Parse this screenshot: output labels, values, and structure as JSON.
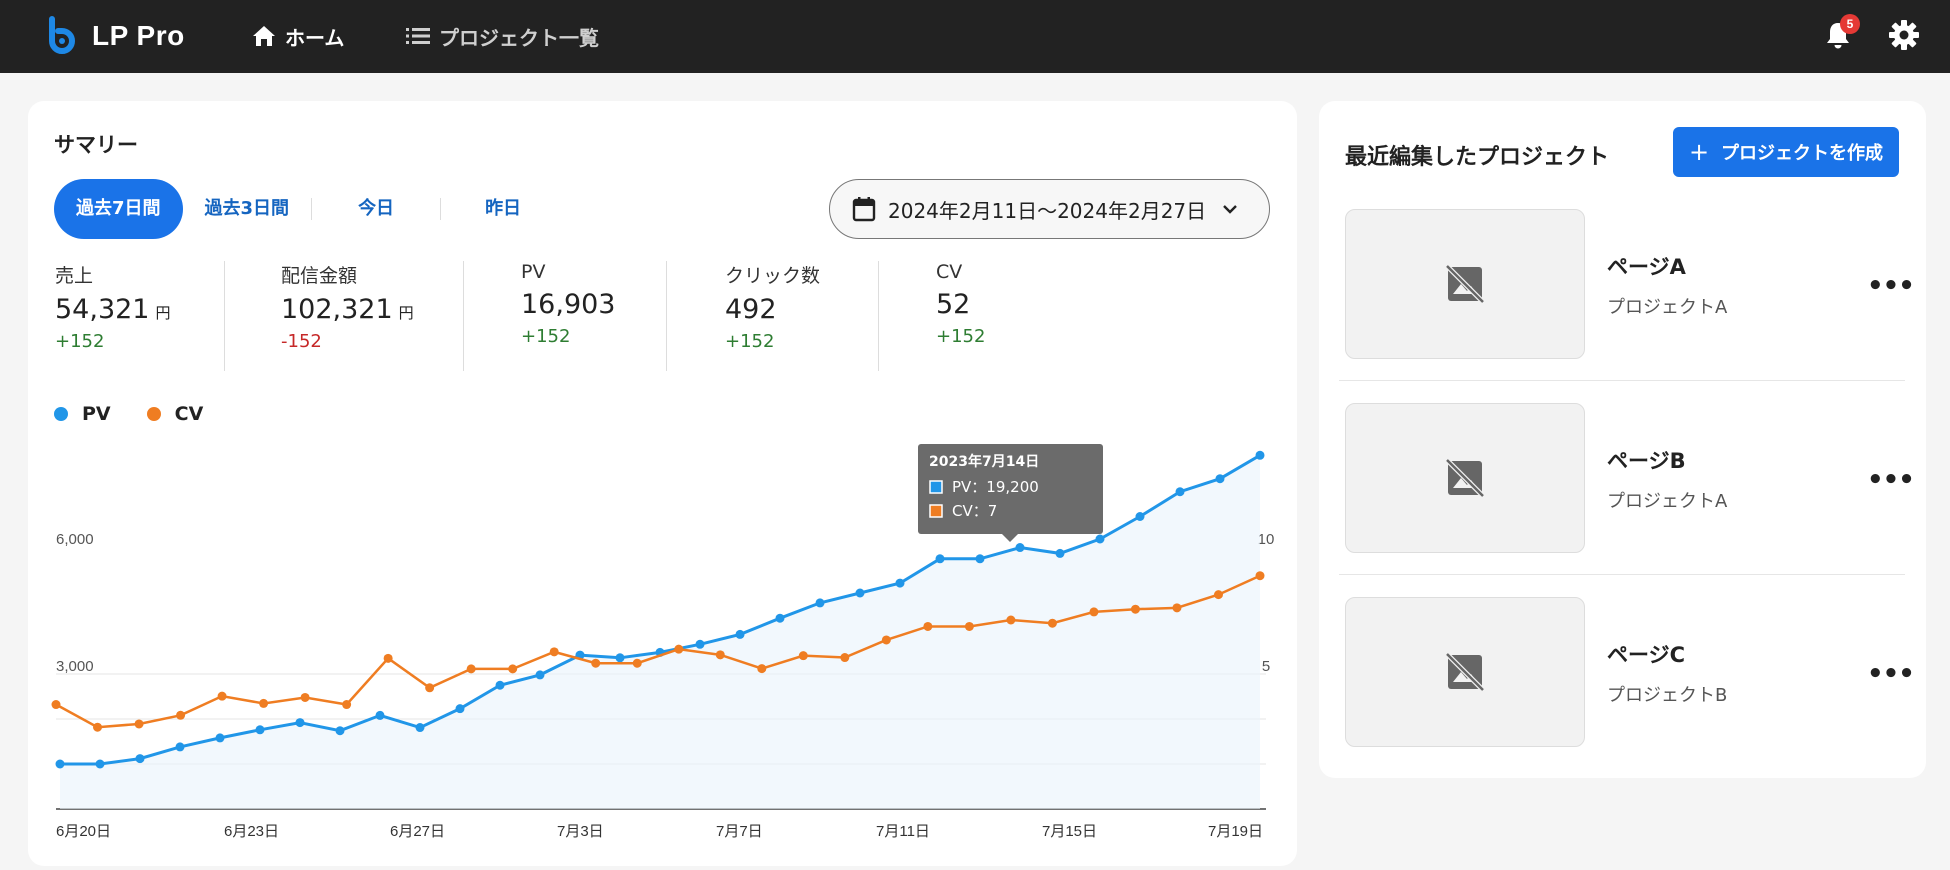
{
  "header": {
    "logo_text": "LP Pro",
    "nav": [
      {
        "label": "ホーム",
        "icon": "home-icon"
      },
      {
        "label": "プロジェクト一覧",
        "icon": "list-icon"
      }
    ],
    "notification_count": "5"
  },
  "summary": {
    "title": "サマリー",
    "range_tabs": [
      "過去7日間",
      "過去3日間",
      "今日",
      "昨日"
    ],
    "active_range": "過去7日間",
    "date_range": "2024年2月11日〜2024年2月27日",
    "kpis": [
      {
        "label": "売上",
        "value": "54,321",
        "unit": "円",
        "delta": "+152"
      },
      {
        "label": "配信金額",
        "value": "102,321",
        "unit": "円",
        "delta": "-152"
      },
      {
        "label": "PV",
        "value": "16,903",
        "unit": "",
        "delta": "+152"
      },
      {
        "label": "クリック数",
        "value": "492",
        "unit": "",
        "delta": "+152"
      },
      {
        "label": "CV",
        "value": "52",
        "unit": "",
        "delta": "+152"
      }
    ],
    "legend": [
      "PV",
      "CV"
    ]
  },
  "chart_data": {
    "type": "line",
    "series": [
      {
        "name": "PV",
        "color": "#2196e8",
        "axis": "left",
        "values": [
          1000,
          1000,
          1120,
          1380,
          1580,
          1760,
          1920,
          1740,
          2080,
          1810,
          2230,
          2750,
          2980,
          3420,
          3360,
          3480,
          3660,
          3880,
          4240,
          4580,
          4800,
          5020,
          5560,
          5560,
          5810,
          5680,
          6000,
          6500,
          7050,
          7340,
          7860
        ]
      },
      {
        "name": "CV",
        "color": "#ef7d22",
        "axis": "right",
        "values": [
          3.87,
          3.03,
          3.15,
          3.47,
          4.18,
          3.91,
          4.13,
          3.87,
          5.58,
          4.49,
          5.19,
          5.19,
          5.82,
          5.4,
          5.4,
          5.92,
          5.71,
          5.2,
          5.68,
          5.61,
          6.26,
          6.76,
          6.76,
          7.0,
          6.88,
          7.3,
          7.4,
          7.45,
          7.94,
          8.64
        ]
      }
    ],
    "x_tick_labels": [
      "6月20日",
      "6月23日",
      "6月27日",
      "7月3日",
      "7月7日",
      "7月11日",
      "7月15日",
      "7月19日"
    ],
    "y_left_ticks": [
      3000,
      6000
    ],
    "y_left_tick_labels": [
      "3,000",
      "6,000"
    ],
    "y_right_ticks": [
      5,
      10
    ],
    "y_right_tick_labels": [
      "5",
      "10"
    ],
    "y_left_range": [
      0,
      6000
    ],
    "y_right_range": [
      0,
      10
    ],
    "tooltip": {
      "title": "2023年7月14日",
      "pv": "PV：19,200",
      "cv": "CV：7"
    },
    "grid": true
  },
  "recent": {
    "title": "最近編集したプロジェクト",
    "create_button": "プロジェクトを作成",
    "projects": [
      {
        "name": "ページA",
        "project": "プロジェクトA"
      },
      {
        "name": "ページB",
        "project": "プロジェクトA"
      },
      {
        "name": "ページC",
        "project": "プロジェクトB"
      }
    ]
  }
}
